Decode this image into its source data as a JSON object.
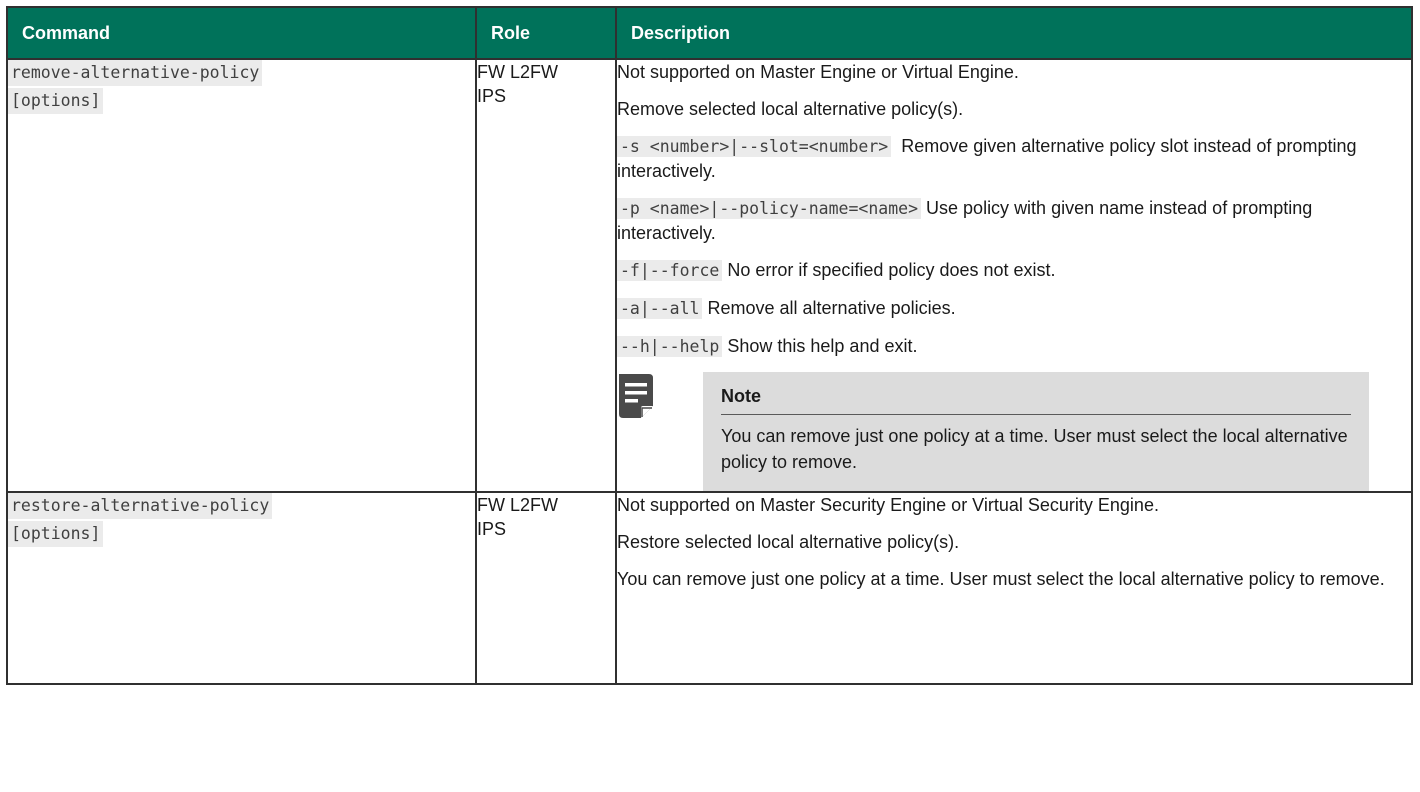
{
  "table": {
    "headers": {
      "command": "Command",
      "role": "Role",
      "description": "Description"
    },
    "rows": [
      {
        "command_line1": "remove-alternative-policy",
        "command_line2": "[options]",
        "role_line1": "FW L2FW",
        "role_line2": "IPS",
        "desc_intro1": "Not supported on Master Engine or Virtual Engine.",
        "desc_intro2": "Remove selected local alternative policy(s).",
        "options": [
          {
            "flag": "-s <number>|--slot=<number>",
            "text": "Remove given alternative policy slot instead of prompting interactively."
          },
          {
            "flag": "-p <name>|--policy-name=<name>",
            "text": "Use policy with given name instead of prompting interactively."
          },
          {
            "flag": "-f|--force",
            "text": "No error if specified policy does not exist."
          },
          {
            "flag": "-a|--all",
            "text": "Remove all alternative policies."
          },
          {
            "flag": "--h|--help",
            "text": "Show this help and exit."
          }
        ],
        "note_title": "Note",
        "note_text": "You can remove just one policy at a time. User must select the local alternative policy to remove."
      },
      {
        "command_line1": "restore-alternative-policy",
        "command_line2": "[options]",
        "role_line1": "FW L2FW",
        "role_line2": "IPS",
        "desc_p1": "Not supported on Master Security Engine or Virtual Security Engine.",
        "desc_p2": "Restore selected local alternative policy(s).",
        "desc_p3": "You can remove just one policy at a time. User must select the local alternative policy to remove."
      }
    ]
  },
  "colors": {
    "header_bg": "#00725a",
    "code_bg": "#ebebeb",
    "note_bg": "#dcdcdc"
  },
  "icons": {
    "note": "note-icon"
  }
}
